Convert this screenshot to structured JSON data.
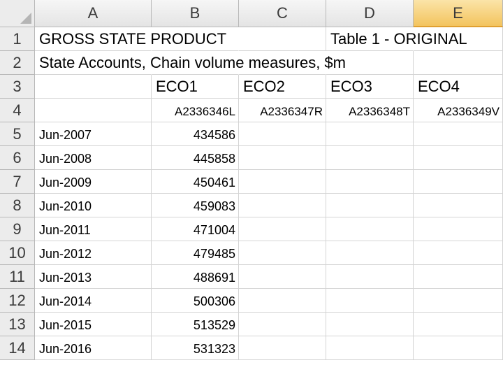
{
  "columns": [
    "A",
    "B",
    "C",
    "D",
    "E"
  ],
  "selected_column": "E",
  "rows": {
    "r1": {
      "num": "1",
      "a": "GROSS STATE PRODUCT",
      "d": "Table 1 - ORIGINAL"
    },
    "r2": {
      "num": "2",
      "a": "State Accounts, Chain volume measures, $m"
    },
    "r3": {
      "num": "3",
      "b": "ECO1",
      "c": "ECO2",
      "d": "ECO3",
      "e": "ECO4"
    },
    "r4": {
      "num": "4",
      "b": "A2336346L",
      "c": "A2336347R",
      "d": "A2336348T",
      "e": "A2336349V"
    }
  },
  "data_rows": [
    {
      "num": "5",
      "date": "Jun-2007",
      "value": "434586"
    },
    {
      "num": "6",
      "date": "Jun-2008",
      "value": "445858"
    },
    {
      "num": "7",
      "date": "Jun-2009",
      "value": "450461"
    },
    {
      "num": "8",
      "date": "Jun-2010",
      "value": "459083"
    },
    {
      "num": "9",
      "date": "Jun-2011",
      "value": "471004"
    },
    {
      "num": "10",
      "date": "Jun-2012",
      "value": "479485"
    },
    {
      "num": "11",
      "date": "Jun-2013",
      "value": "488691"
    },
    {
      "num": "12",
      "date": "Jun-2014",
      "value": "500306"
    },
    {
      "num": "13",
      "date": "Jun-2015",
      "value": "513529"
    },
    {
      "num": "14",
      "date": "Jun-2016",
      "value": "531323"
    }
  ]
}
